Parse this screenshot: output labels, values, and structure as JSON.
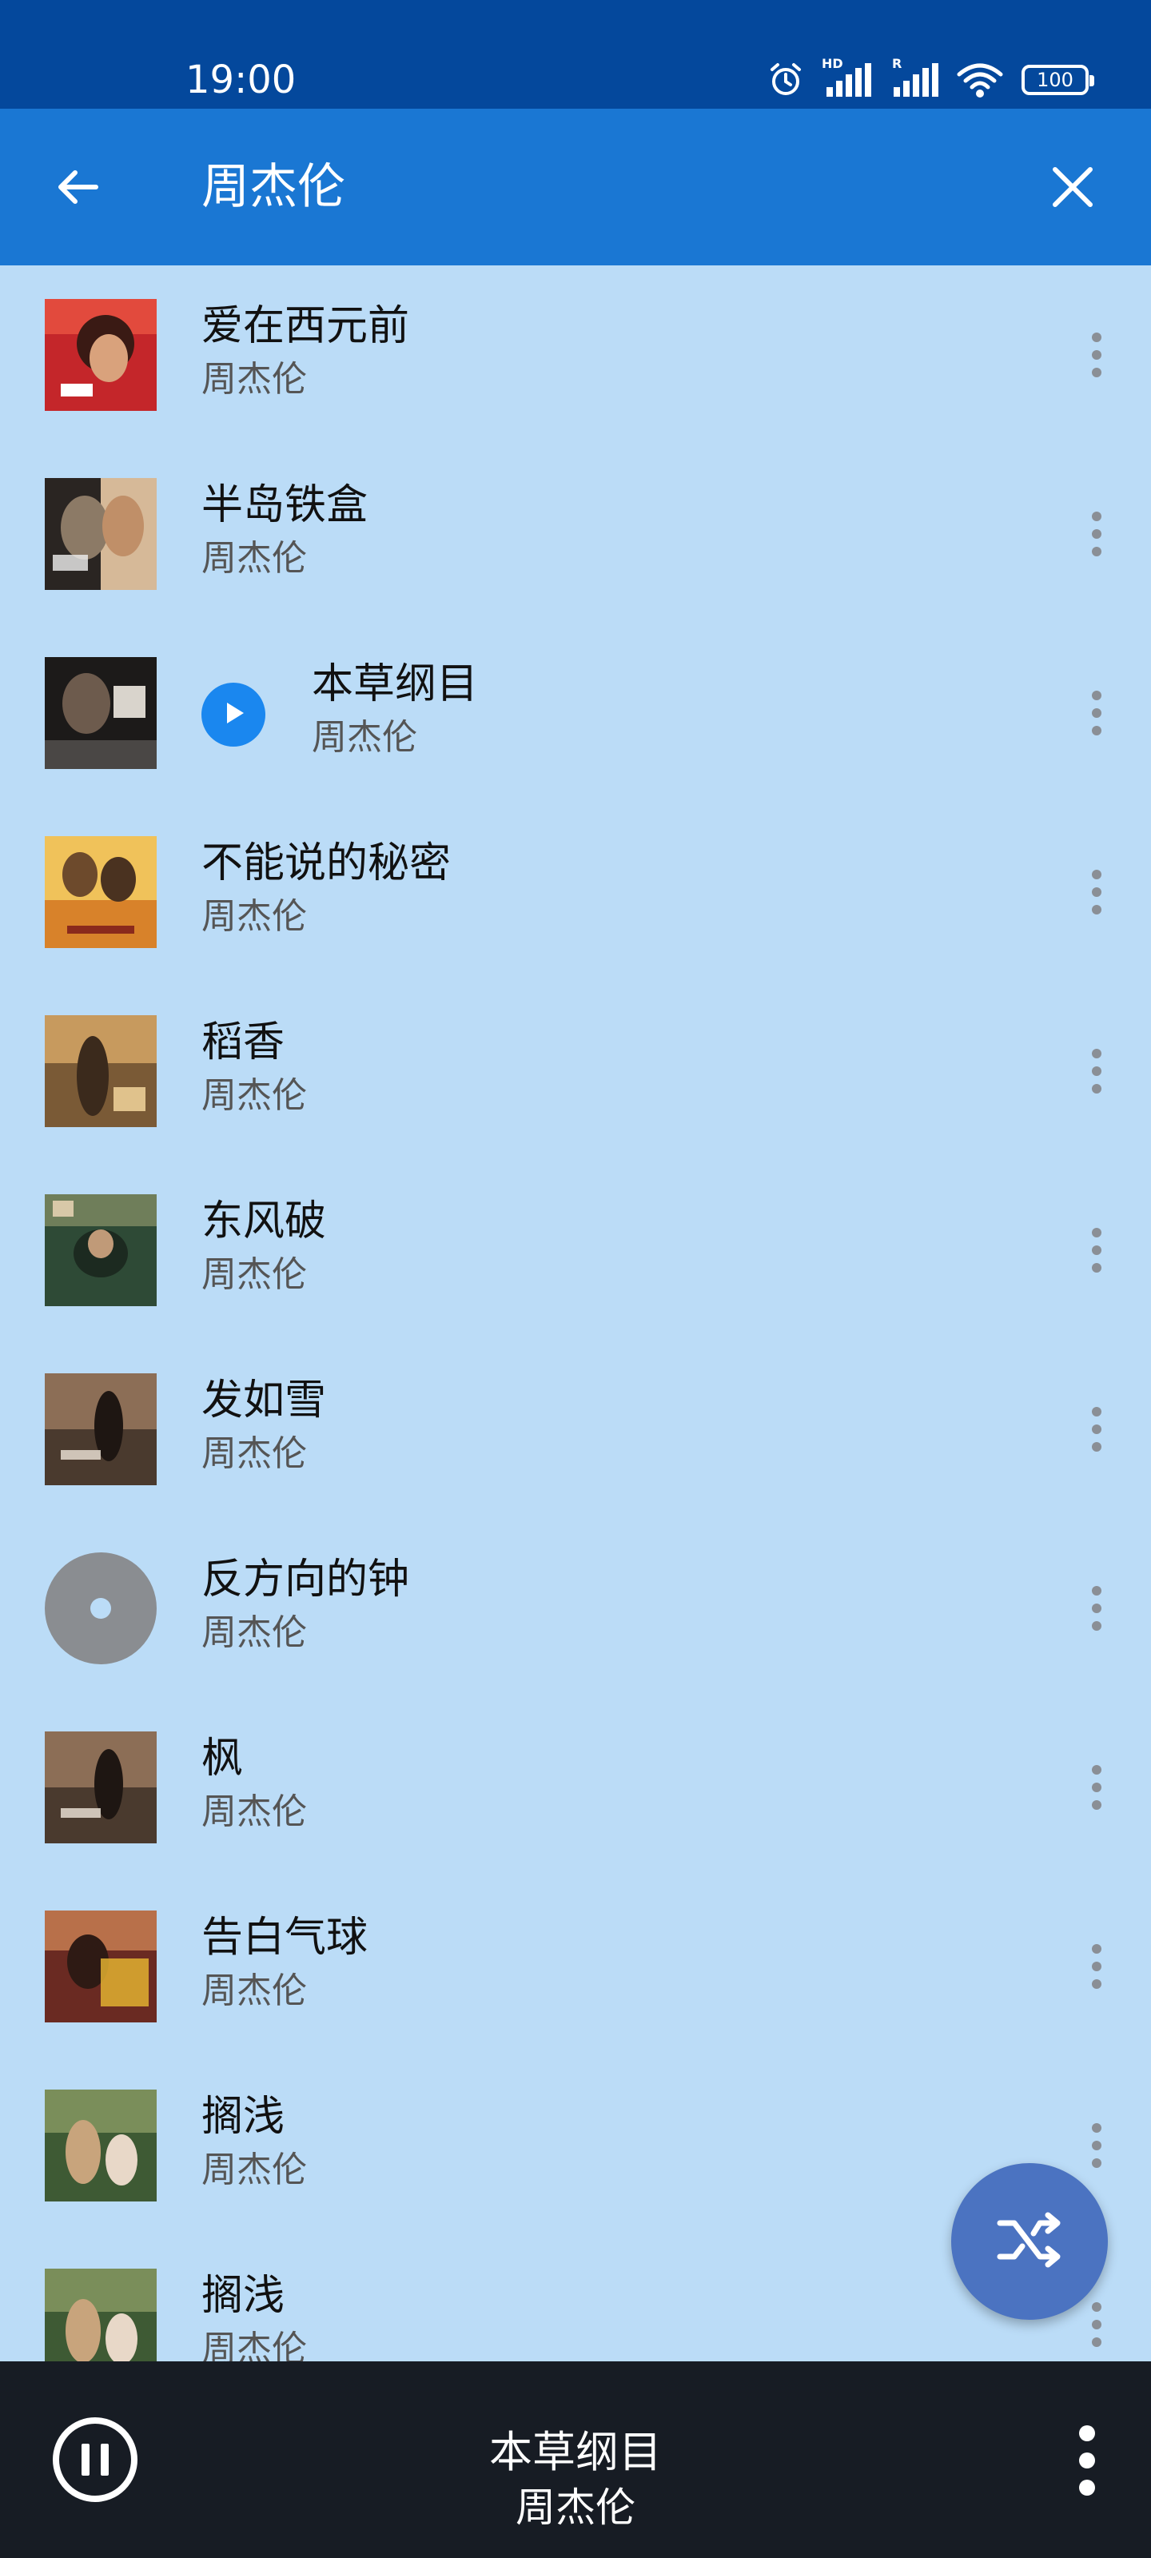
{
  "status_bar": {
    "time": "19:00",
    "hd_label": "HD",
    "roaming_label": "R",
    "battery_level": "100",
    "icons": [
      "alarm-icon",
      "signal-hd-icon",
      "signal-r-icon",
      "wifi-icon",
      "battery-icon"
    ]
  },
  "app_bar": {
    "title": "周杰伦",
    "back_icon": "arrow-left-icon",
    "close_icon": "close-icon",
    "background": "#1a77d3"
  },
  "songs": [
    {
      "title": "爱在西元前",
      "artist": "周杰伦",
      "cover": "album-art-red"
    },
    {
      "title": "半岛铁盒",
      "artist": "周杰伦",
      "cover": "album-art-split"
    },
    {
      "title": "本草纲目",
      "artist": "周杰伦",
      "cover": "album-art-dark",
      "playing": true
    },
    {
      "title": "不能说的秘密",
      "artist": "周杰伦",
      "cover": "album-art-yellow"
    },
    {
      "title": "稻香",
      "artist": "周杰伦",
      "cover": "album-art-golden"
    },
    {
      "title": "东风破",
      "artist": "周杰伦",
      "cover": "album-art-green"
    },
    {
      "title": "发如雪",
      "artist": "周杰伦",
      "cover": "album-art-sepia"
    },
    {
      "title": "反方向的钟",
      "artist": "周杰伦",
      "cover": "default-disc-icon"
    },
    {
      "title": "枫",
      "artist": "周杰伦",
      "cover": "album-art-sepia"
    },
    {
      "title": "告白气球",
      "artist": "周杰伦",
      "cover": "album-art-red-orange"
    },
    {
      "title": "搁浅",
      "artist": "周杰伦",
      "cover": "album-art-forest"
    },
    {
      "title": "搁浅",
      "artist": "周杰伦",
      "cover": "album-art-forest"
    }
  ],
  "fab": {
    "icon": "shuffle-icon",
    "color": "#4b73c1"
  },
  "now_playing": {
    "title": "本草纲目",
    "artist": "周杰伦",
    "pause_icon": "pause-icon",
    "more_icon": "more-vert-icon"
  },
  "colors": {
    "status_bar": "#04489c",
    "list_background": "#bbdcf7",
    "player_bar": "#171c24",
    "play_indicator": "#1a87ef"
  }
}
